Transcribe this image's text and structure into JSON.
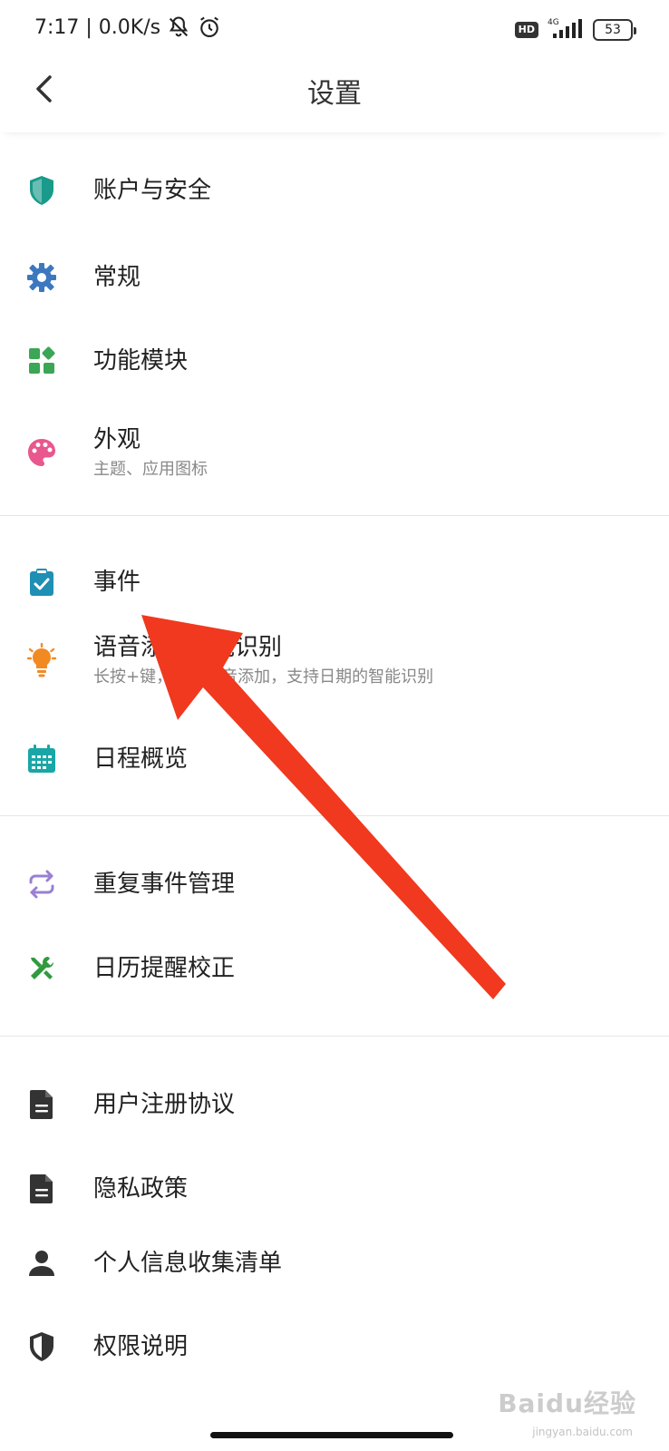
{
  "status_bar": {
    "time_speed": "7:17 | 0.0K/s",
    "hd": "HD",
    "network": "4G",
    "battery": "53"
  },
  "header": {
    "title": "设置"
  },
  "items": [
    {
      "label": "账户与安全",
      "icon": "shield-icon",
      "color": "#1a9a8a"
    },
    {
      "label": "常规",
      "icon": "gear-icon",
      "color": "#3b78c0"
    },
    {
      "label": "功能模块",
      "icon": "modules-icon",
      "color": "#3aa656"
    },
    {
      "label": "外观",
      "sub": "主题、应用图标",
      "icon": "palette-icon",
      "color": "#e8578d"
    },
    {
      "label": "事件",
      "icon": "clipboard-check-icon",
      "color": "#1f8fb3"
    },
    {
      "label": "语音添加智能识别",
      "sub": "长按+键，快捷语音添加，支持日期的智能识别",
      "icon": "lightbulb-icon",
      "color": "#f28a24"
    },
    {
      "label": "日程概览",
      "icon": "calendar-icon",
      "color": "#1aa6a6"
    },
    {
      "label": "重复事件管理",
      "icon": "repeat-icon",
      "color": "#9b7fd4"
    },
    {
      "label": "日历提醒校正",
      "icon": "tools-icon",
      "color": "#2f9a3e"
    },
    {
      "label": "用户注册协议",
      "icon": "document-icon",
      "color": "#333333"
    },
    {
      "label": "隐私政策",
      "icon": "document-icon",
      "color": "#333333"
    },
    {
      "label": "个人信息收集清单",
      "icon": "person-icon",
      "color": "#333333"
    },
    {
      "label": "权限说明",
      "icon": "shield-half-icon",
      "color": "#333333"
    }
  ],
  "watermark": {
    "brand": "Baidu经验",
    "url": "jingyan.baidu.com"
  },
  "annotation": {
    "arrow_color": "#f0391e"
  }
}
